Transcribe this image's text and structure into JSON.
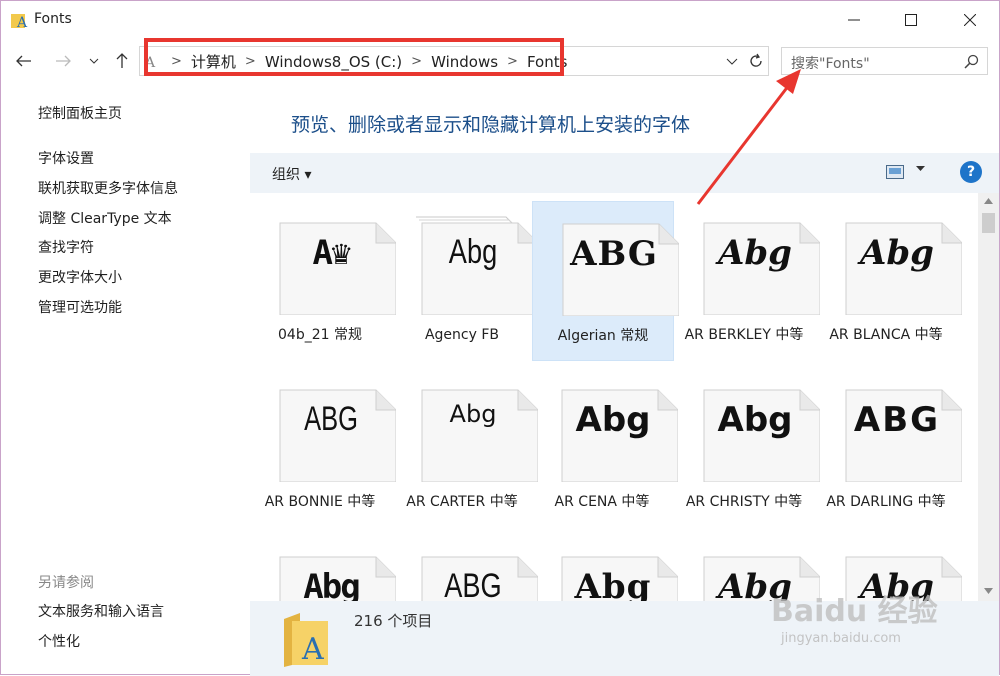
{
  "window": {
    "title": "Fonts"
  },
  "address": {
    "crumbs": [
      "计算机",
      "Windows8_OS (C:)",
      "Windows",
      "Fonts"
    ],
    "search_placeholder": "搜索\"Fonts\""
  },
  "sidebar": {
    "home": "控制面板主页",
    "links": [
      "字体设置",
      "联机获取更多字体信息",
      "调整 ClearType 文本",
      "查找字符",
      "更改字体大小",
      "管理可选功能"
    ],
    "see_also_heading": "另请参阅",
    "see_also": [
      "文本服务和输入语言",
      "个性化"
    ]
  },
  "main": {
    "heading": "预览、删除或者显示和隐藏计算机上安装的字体",
    "organize_label": "组织 ▾",
    "help": "?"
  },
  "fonts": [
    {
      "name": "04b_21 常规",
      "preview": "A♛"
    },
    {
      "name": "Agency FB",
      "preview": "Abg"
    },
    {
      "name": "Algerian 常规",
      "preview": "ABG"
    },
    {
      "name": "AR BERKLEY 中等",
      "preview": "Abg"
    },
    {
      "name": "AR BLANCA 中等",
      "preview": "Abg"
    },
    {
      "name": "AR BONNIE 中等",
      "preview": "ABG"
    },
    {
      "name": "AR CARTER 中等",
      "preview": "Abg"
    },
    {
      "name": "AR CENA 中等",
      "preview": "Abg"
    },
    {
      "name": "AR CHRISTY 中等",
      "preview": "Abg"
    },
    {
      "name": "AR DARLING 中等",
      "preview": "ABG"
    },
    {
      "name": "",
      "preview": "Abg"
    },
    {
      "name": "",
      "preview": "ABG"
    },
    {
      "name": "",
      "preview": "Abg"
    },
    {
      "name": "",
      "preview": "Abg"
    },
    {
      "name": "",
      "preview": "Abg"
    }
  ],
  "status": {
    "count_text": "216 个项目"
  },
  "watermark": {
    "brand": "Baidu 经验",
    "url": "jingyan.baidu.com"
  },
  "colors": {
    "highlight_red": "#e8362f",
    "heading_blue": "#1c4f8a",
    "toolbar_bg": "#eef3f8",
    "selected_bg": "#dcebfa"
  }
}
